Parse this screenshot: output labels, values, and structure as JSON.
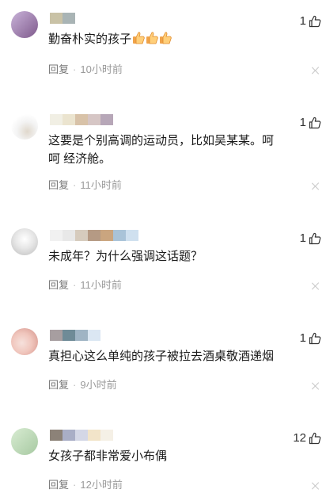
{
  "reply_label": "回复",
  "close_glyph": "×",
  "comments": [
    {
      "text": "勤奋朴实的孩子",
      "time": "10小时前",
      "likes": "1",
      "emoji": "thumbs-up-emoji",
      "avatar_colors": [
        "#b39bc7",
        "#7f5a8c"
      ],
      "name_colors": [
        "#c9c2a6",
        "#a9b4b5"
      ]
    },
    {
      "text": "这要是个别高调的运动员，比如吴某某。呵呵 经济舱。",
      "time": "11小时前",
      "likes": "1",
      "avatar_colors": [
        "#f2f2f2",
        "#d7d7d7"
      ],
      "name_colors": [
        "#f1efe4",
        "#ebe4cf",
        "#d8c2a8",
        "#d6c6c5",
        "#b7a7b8"
      ]
    },
    {
      "text": "未成年？为什么强调这话题？",
      "time": "11小时前",
      "likes": "1",
      "avatar_colors": [
        "#e3e3e3",
        "#b9b9b9"
      ],
      "name_colors": [
        "#f1f1f1",
        "#e8e8e8",
        "#d6cbbd",
        "#b59a84",
        "#caa57f",
        "#a9c3d8",
        "#cfe0ef"
      ]
    },
    {
      "text": "真担心这么单纯的孩子被拉去酒桌敬酒递烟",
      "time": "9小时前",
      "likes": "1",
      "avatar_colors": [
        "#f3d2cc",
        "#d99c92"
      ],
      "name_colors": [
        "#a79ea0",
        "#6f8b97",
        "#9fb4c4",
        "#dbe7f3"
      ]
    },
    {
      "text": "女孩子都非常爱小布偶",
      "time": "12小时前",
      "likes": "12",
      "avatar_colors": [
        "#c7e2c0",
        "#a7c9a2"
      ],
      "name_colors": [
        "#8c8278",
        "#a9aec6",
        "#d4d7e6",
        "#f2e4c9",
        "#f5f0e6"
      ]
    }
  ]
}
